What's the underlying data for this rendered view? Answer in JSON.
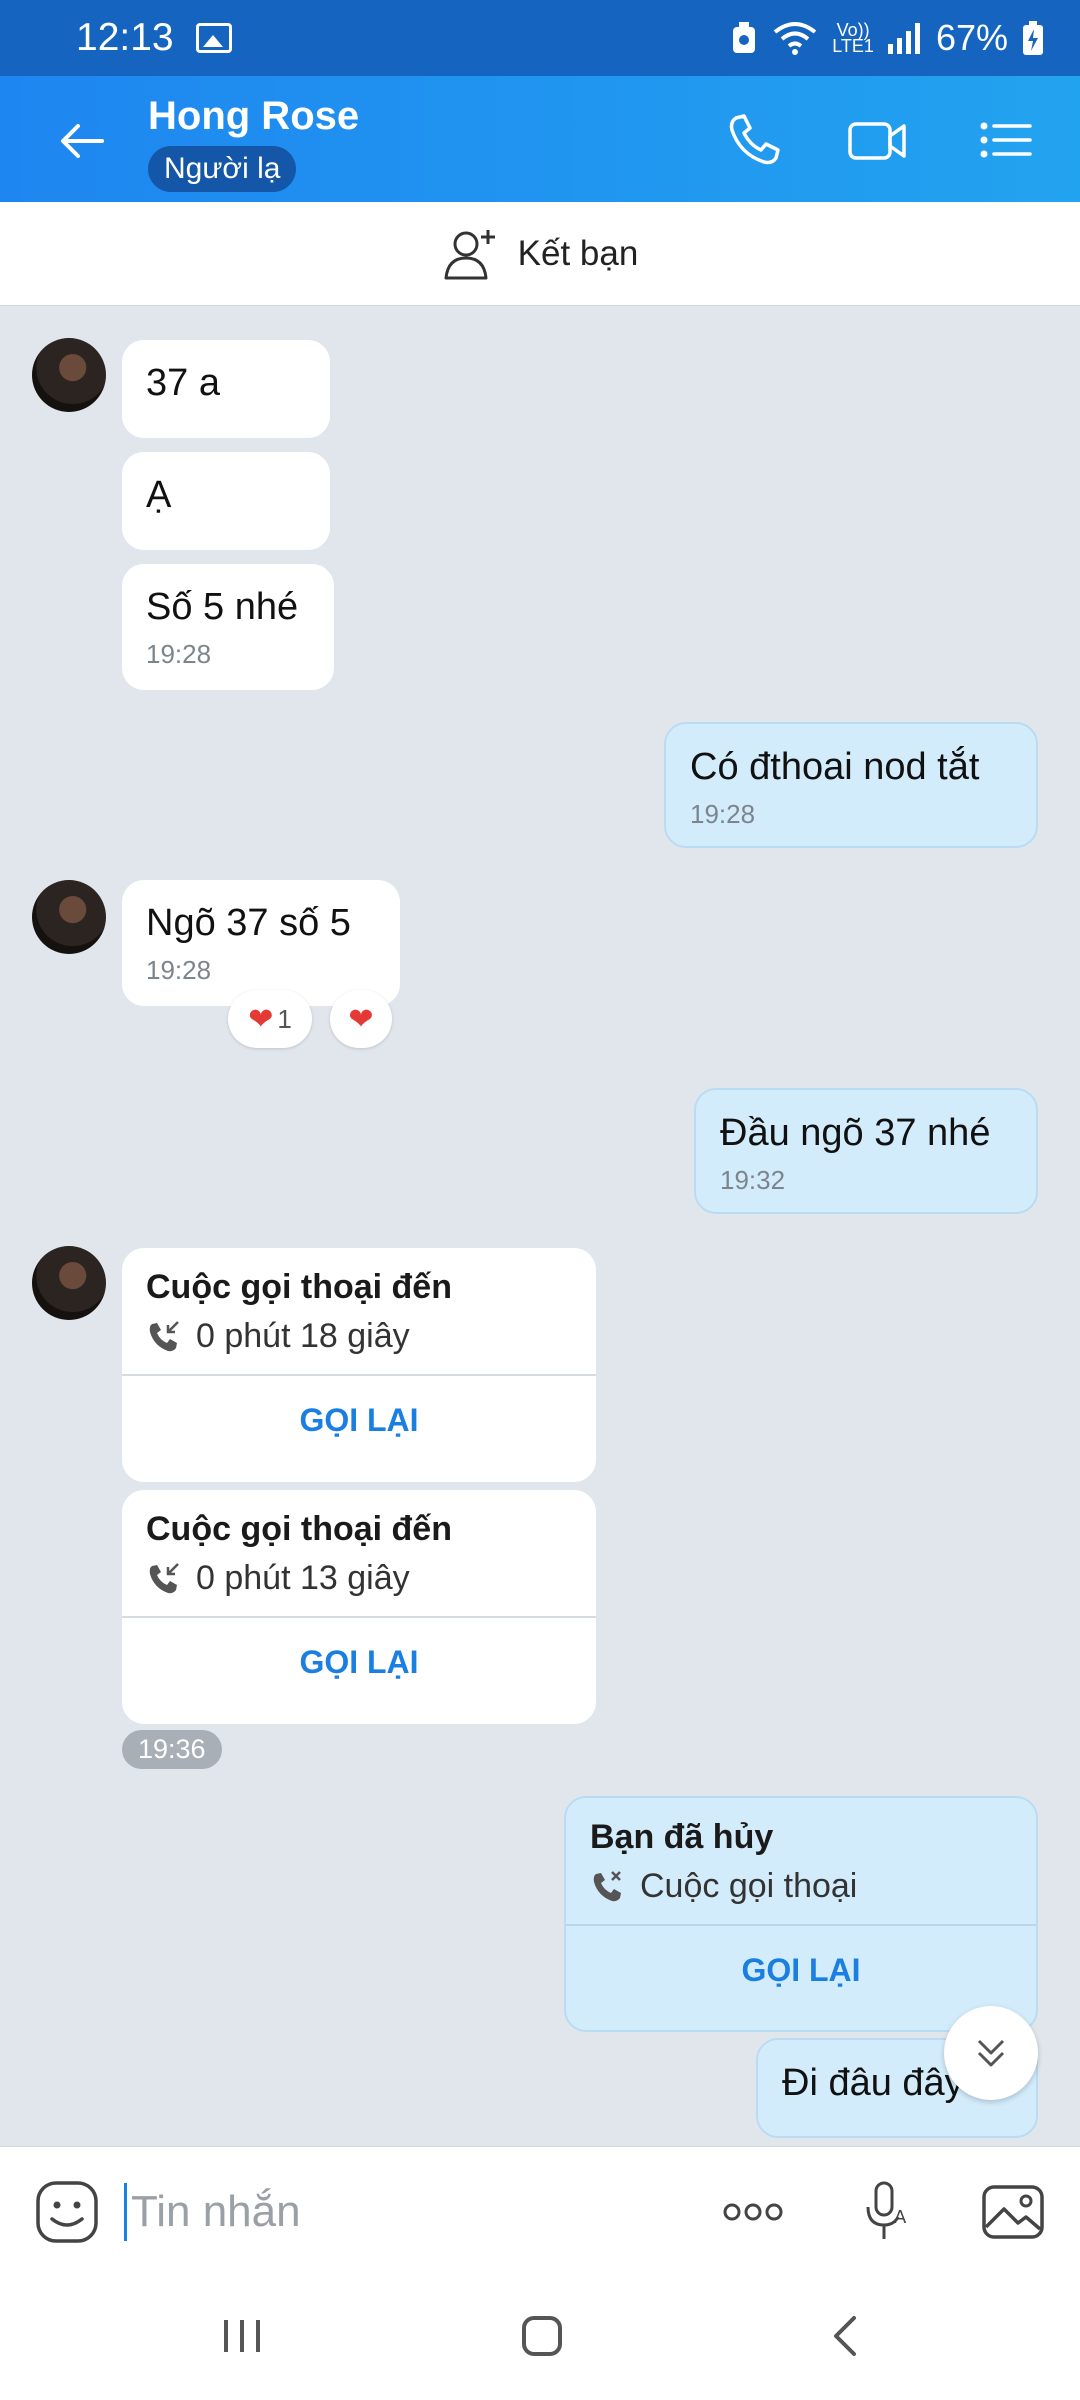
{
  "status_bar": {
    "time": "12:13",
    "network_top": "Vo))",
    "network_bottom": "LTE1",
    "battery": "67%"
  },
  "header": {
    "contact_name": "Hong Rose",
    "badge": "Người lạ"
  },
  "add_friend": {
    "label": "Kết bạn"
  },
  "messages": {
    "m1": {
      "text": "37 a"
    },
    "m2": {
      "text": "Ạ"
    },
    "m3": {
      "text": "Số 5 nhé",
      "time": "19:28"
    },
    "m4": {
      "text": "Có đthoai nod tắt",
      "time": "19:28"
    },
    "m5": {
      "text": "Ngõ 37 số 5",
      "time": "19:28",
      "reaction_count": "1"
    },
    "m6": {
      "text": "Đầu ngõ 37 nhé",
      "time": "19:32"
    },
    "call1": {
      "title": "Cuộc gọi thoại đến",
      "duration": "0 phút 18 giây",
      "action": "GỌI LẠI"
    },
    "call2": {
      "title": "Cuộc gọi thoại đến",
      "duration": "0 phút 13 giây",
      "action": "GỌI LẠI"
    },
    "time_chip": "19:36",
    "call3": {
      "title": "Bạn đã hủy",
      "subtitle": "Cuộc gọi thoại",
      "action": "GỌI LẠI"
    },
    "m7": {
      "text": "Đi đâu đây ^"
    }
  },
  "input": {
    "placeholder": "Tin nhắn"
  },
  "colors": {
    "header_start": "#1e86f0",
    "header_end": "#22a3ef",
    "my_bubble": "#d3ecfb",
    "accent": "#1a7fe0"
  }
}
